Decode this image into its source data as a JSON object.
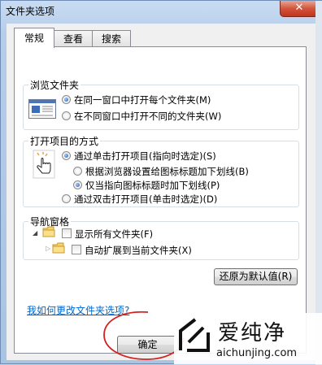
{
  "window": {
    "title": "文件夹选项",
    "close": "✕"
  },
  "tabs": [
    {
      "label": "常规"
    },
    {
      "label": "查看"
    },
    {
      "label": "搜索"
    }
  ],
  "browse": {
    "title": "浏览文件夹",
    "options": [
      "在同一窗口中打开每个文件夹(M)",
      "在不同窗口中打开不同的文件夹(W)"
    ],
    "selected": 0
  },
  "click": {
    "title": "打开项目的方式",
    "options": [
      "通过单击打开项目(指向时选定)(S)",
      "根据浏览器设置给图标标题加下划线(B)",
      "仅当指向图标标题时加下划线(P)",
      "通过双击打开项目(单击时选定)(D)"
    ]
  },
  "nav": {
    "title": "导航窗格",
    "options": [
      "显示所有文件夹(F)",
      "自动扩展到当前文件夹(X)"
    ]
  },
  "restore_label": "还原为默认值(R)",
  "help_link": "我如何更改文件夹选项?",
  "ok_label": "确定",
  "watermark": {
    "brand": "爱纯净",
    "url": "aichunjing.com"
  },
  "colors": {
    "accent": "#1a5bb8",
    "link": "#0066cc",
    "highlight_circle": "#d42020"
  }
}
